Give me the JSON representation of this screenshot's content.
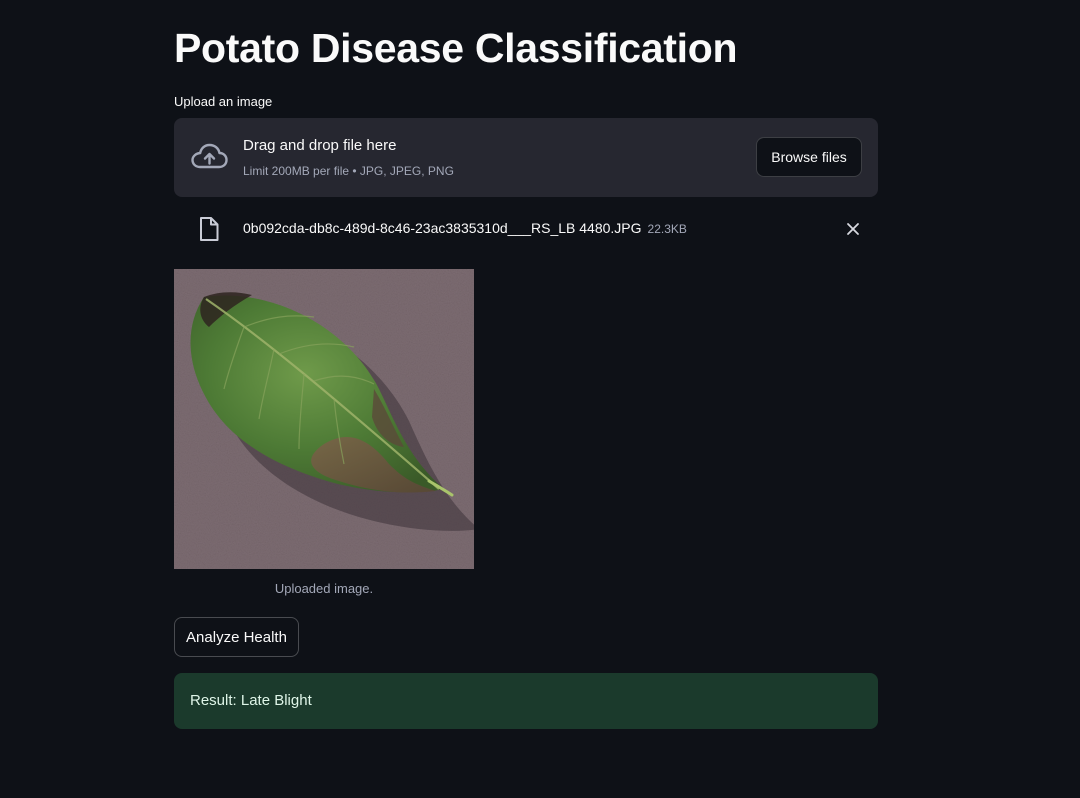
{
  "header": {
    "title": "Potato Disease Classification"
  },
  "uploader": {
    "label": "Upload an image",
    "drop_title": "Drag and drop file here",
    "limit_text": "Limit 200MB per file • JPG, JPEG, PNG",
    "browse_label": "Browse files",
    "upload_icon": "cloud-upload-icon"
  },
  "uploaded_file": {
    "icon": "file-icon",
    "name": "0b092cda-db8c-489d-8c46-23ac3835310d___RS_LB 4480.JPG",
    "size": "22.3KB",
    "remove_icon": "close-icon"
  },
  "image": {
    "caption": "Uploaded image."
  },
  "actions": {
    "analyze_label": "Analyze Health"
  },
  "result": {
    "text": "Result: Late Blight"
  },
  "colors": {
    "background": "#0e1117",
    "dropzone": "#262730",
    "success_bg": "#1b3a2c",
    "muted_text": "#a3a8b8"
  }
}
